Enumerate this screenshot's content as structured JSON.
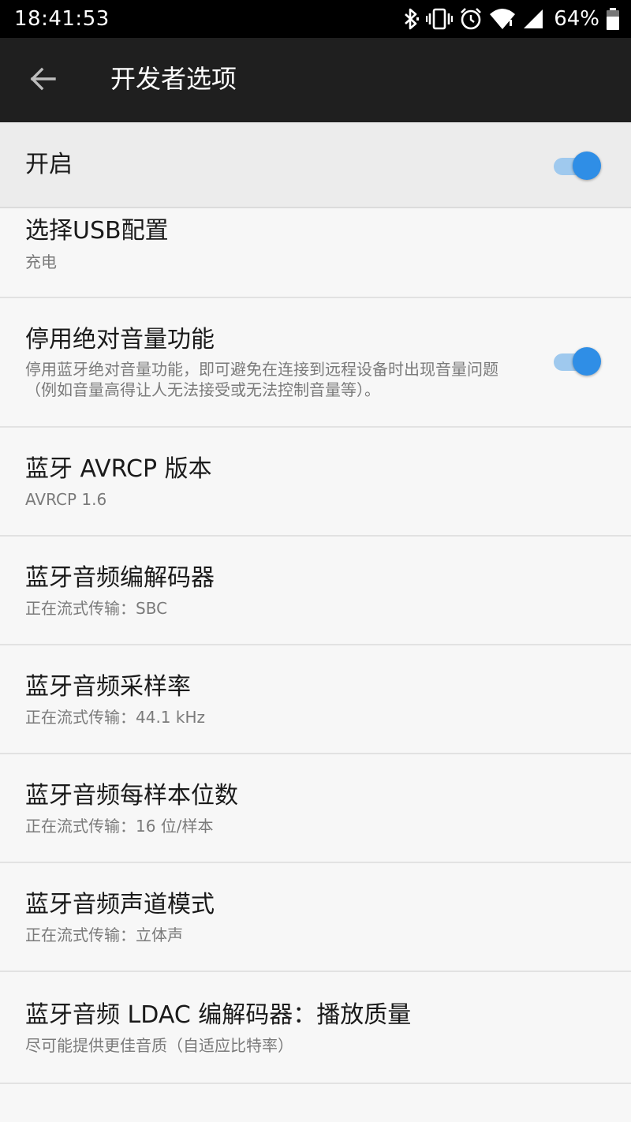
{
  "status_bar": {
    "time": "18:41:53",
    "battery": "64%",
    "icons": [
      "bluetooth-icon",
      "vibrate-icon",
      "alarm-icon",
      "wifi-icon",
      "signal-icon",
      "battery-icon"
    ]
  },
  "app_bar": {
    "back_icon": "back-arrow-icon",
    "title": "开发者选项"
  },
  "master_switch": {
    "label": "开启",
    "enabled": true
  },
  "colors": {
    "accent": "#2f8ee6",
    "toggle_track": "#9fc9ee",
    "app_bar_bg": "#1f1f1f"
  },
  "settings": [
    {
      "title": "选择USB配置",
      "summary": "充电"
    },
    {
      "title": "停用绝对音量功能",
      "summary": "停用蓝牙绝对音量功能，即可避免在连接到远程设备时出现音量问题（例如音量高得让人无法接受或无法控制音量等）。",
      "toggle": true
    },
    {
      "title": "蓝牙 AVRCP 版本",
      "summary": "AVRCP 1.6"
    },
    {
      "title": "蓝牙音频编解码器",
      "summary": "正在流式传输：SBC"
    },
    {
      "title": "蓝牙音频采样率",
      "summary": "正在流式传输：44.1 kHz"
    },
    {
      "title": "蓝牙音频每样本位数",
      "summary": "正在流式传输：16 位/样本"
    },
    {
      "title": "蓝牙音频声道模式",
      "summary": "正在流式传输：立体声"
    },
    {
      "title": "蓝牙音频 LDAC 编解码器：播放质量",
      "summary": "尽可能提供更佳音质（自适应比特率）"
    }
  ]
}
